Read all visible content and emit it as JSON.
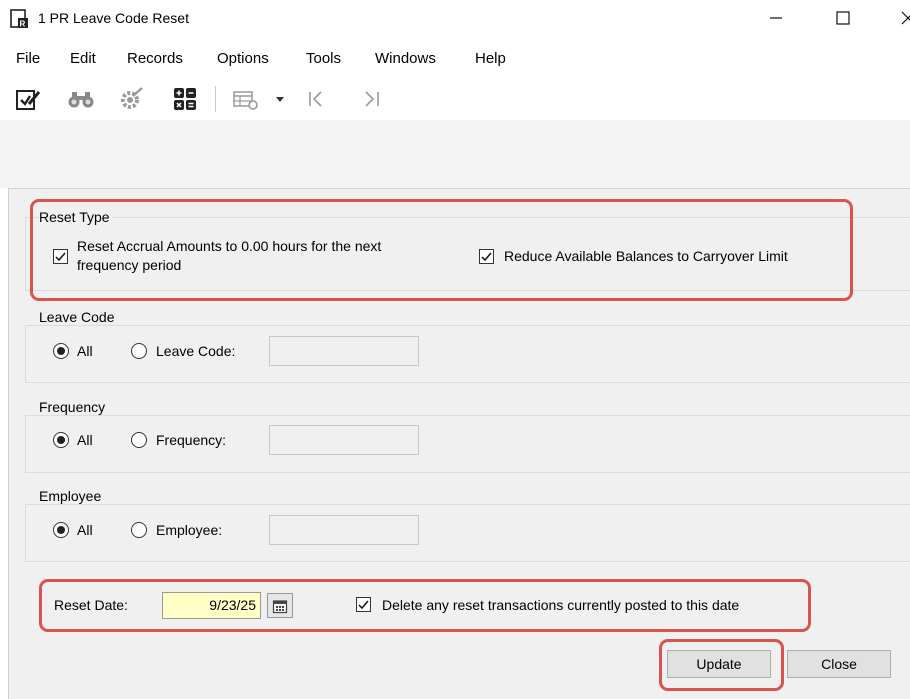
{
  "window": {
    "title": "1 PR Leave Code Reset",
    "icons": {
      "app": "app-icon",
      "minimize": "minimize-icon",
      "maximize": "maximize-icon",
      "close": "close-icon"
    }
  },
  "menu": {
    "items": [
      "File",
      "Edit",
      "Records",
      "Options",
      "Tools",
      "Windows",
      "Help"
    ]
  },
  "toolbar": {
    "icons": [
      "edit-checklist-icon",
      "binoculars-icon",
      "gear-icon",
      "calculator-icon",
      "grid-settings-icon",
      "dropdown-arrow-icon",
      "first-record-icon",
      "last-record-icon"
    ]
  },
  "reset_type": {
    "title": "Reset Type",
    "reset_accrual": {
      "label_line1": "Reset Accrual Amounts to 0.00 hours for the next",
      "label_line2": "frequency period",
      "checked": true
    },
    "reduce_balances": {
      "label": "Reduce Available Balances to Carryover Limit",
      "checked": true
    }
  },
  "leave_code": {
    "title": "Leave Code",
    "all_label": "All",
    "specific_label": "Leave Code:",
    "selected": "All",
    "value": ""
  },
  "frequency": {
    "title": "Frequency",
    "all_label": "All",
    "specific_label": "Frequency:",
    "selected": "All",
    "value": ""
  },
  "employee": {
    "title": "Employee",
    "all_label": "All",
    "specific_label": "Employee:",
    "selected": "All",
    "value": ""
  },
  "reset_date": {
    "label": "Reset Date:",
    "value": "9/23/25",
    "calendar_icon": "calendar-icon",
    "delete_existing": {
      "label": "Delete any reset transactions currently posted to this date",
      "checked": true
    }
  },
  "buttons": {
    "update": "Update",
    "close": "Close"
  },
  "colors": {
    "highlight": "#d9534f",
    "date_field": "#ffffc6",
    "panel": "#f0f0f0"
  }
}
